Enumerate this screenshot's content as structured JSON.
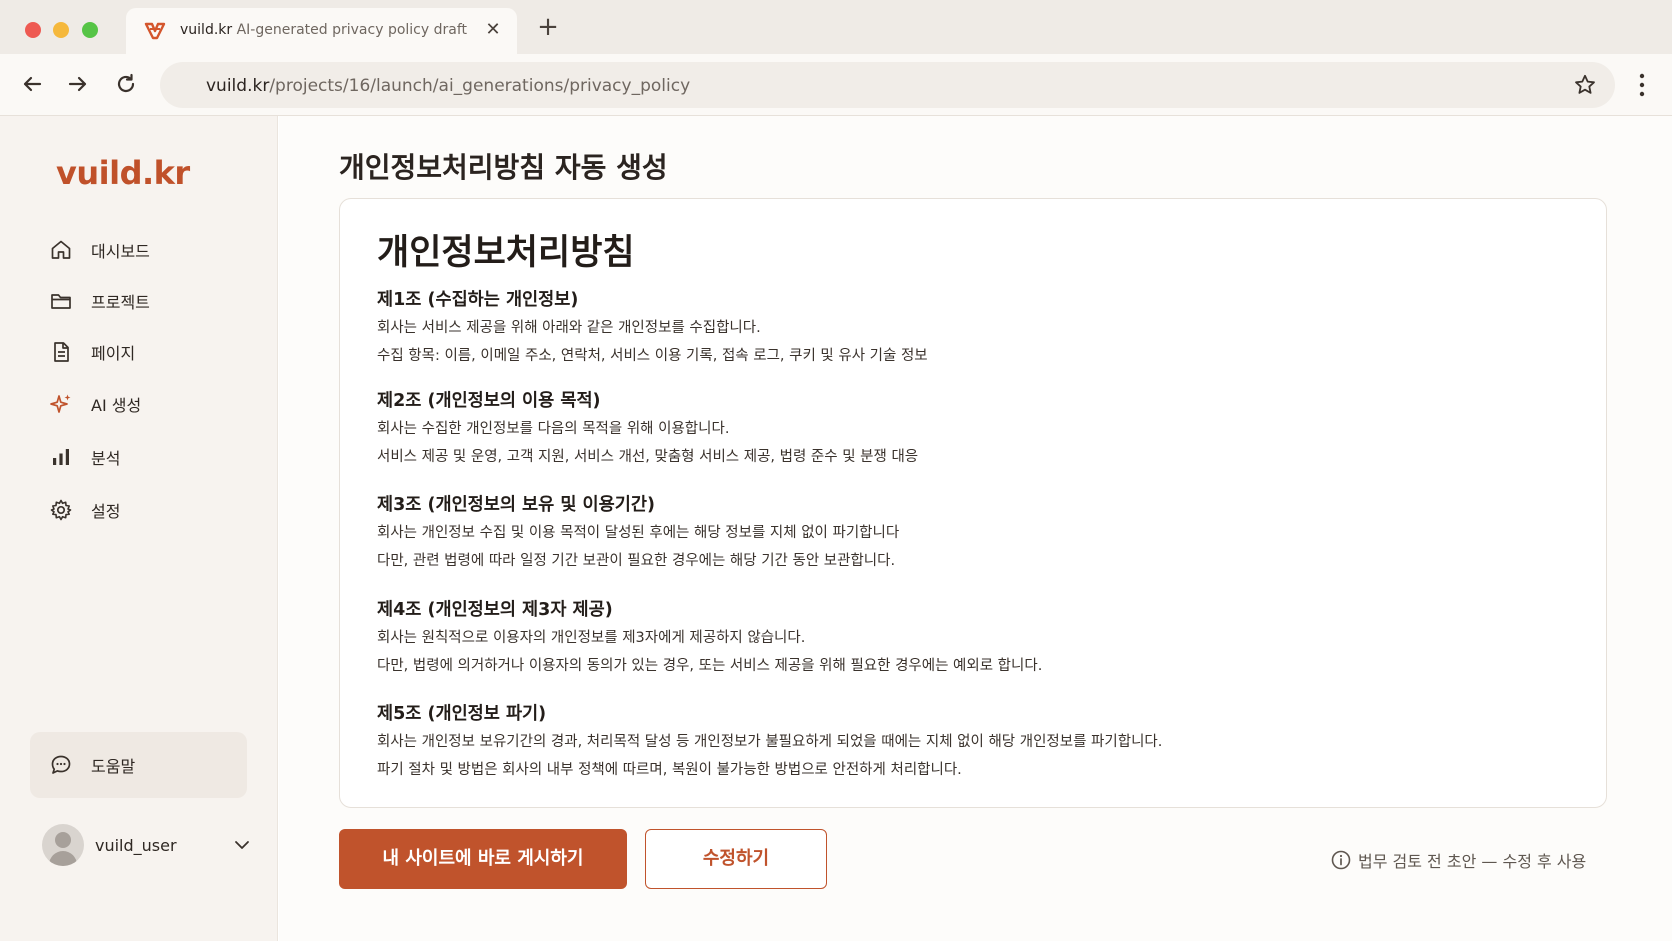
{
  "browser": {
    "tab": {
      "title_main": "vuild.kr",
      "title_sub": "AI-generated privacy policy draft",
      "close_glyph": "✕"
    },
    "new_tab_glyph": "+",
    "url": {
      "host": "vuild.kr",
      "path": "/projects/16/launch/ai_generations/privacy_policy"
    }
  },
  "sidebar": {
    "logo": "vuild.kr",
    "items": [
      {
        "label": "대시보드",
        "icon": "home-icon"
      },
      {
        "label": "프로젝트",
        "icon": "folder-icon"
      },
      {
        "label": "페이지",
        "icon": "document-icon"
      },
      {
        "label": "AI 생성",
        "icon": "sparkle-icon"
      },
      {
        "label": "분석",
        "icon": "bar-chart-icon"
      },
      {
        "label": "설정",
        "icon": "gear-icon"
      }
    ],
    "help": {
      "label": "도움말",
      "icon": "chat-bubble-icon"
    },
    "user": {
      "name": "vuild_user"
    }
  },
  "main": {
    "page_title": "개인정보처리방침 자동 생성",
    "document": {
      "title": "개인정보처리방침",
      "articles": [
        {
          "heading": "제1조 (수집하는 개인정보)",
          "lines": [
            "회사는 서비스 제공을 위해 아래와 같은 개인정보를 수집합니다.",
            "수집 항목: 이름, 이메일 주소, 연락처, 서비스 이용 기록, 접속 로그, 쿠키 및 유사 기술 정보"
          ]
        },
        {
          "heading": "제2조 (개인정보의 이용 목적)",
          "lines": [
            "회사는 수집한 개인정보를 다음의 목적을 위해 이용합니다.",
            "서비스 제공 및 운영, 고객 지원, 서비스 개선, 맞춤형 서비스 제공, 법령 준수 및 분쟁 대응"
          ]
        },
        {
          "heading": "제3조 (개인정보의 보유 및 이용기간)",
          "lines": [
            "회사는 개인정보 수집 및 이용 목적이 달성된 후에는 해당 정보를 지체 없이 파기합니다",
            "다만, 관련 법령에 따라 일정 기간 보관이 필요한 경우에는 해당 기간 동안 보관합니다."
          ]
        },
        {
          "heading": "제4조 (개인정보의 제3자 제공)",
          "lines": [
            "회사는 원칙적으로 이용자의 개인정보를 제3자에게 제공하지 않습니다.",
            "다만, 법령에 의거하거나 이용자의 동의가 있는 경우, 또는 서비스 제공을 위해 필요한 경우에는 예외로 합니다."
          ]
        },
        {
          "heading": "제5조 (개인정보 파기)",
          "lines": [
            "회사는 개인정보 보유기간의 경과, 처리목적 달성 등 개인정보가 불필요하게 되었을 때에는 지체 없이 해당 개인정보를 파기합니다.",
            "파기 절차 및 방법은 회사의 내부 정책에 따르며, 복원이 불가능한 방법으로 안전하게 처리합니다."
          ]
        }
      ]
    },
    "actions": {
      "publish_label": "내 사이트에 바로 게시하기",
      "edit_label": "수정하기"
    },
    "notice": "법무 검토 전 초안 — 수정 후 사용"
  },
  "colors": {
    "accent": "#c0532c",
    "sidebar_bg": "#f7f3ef",
    "chrome_bg": "#efebe6"
  }
}
